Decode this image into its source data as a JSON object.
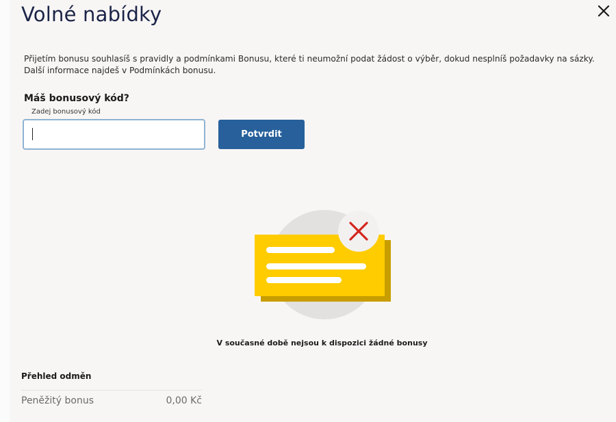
{
  "header": {
    "title": "Volné nabídky",
    "close_icon": "close-icon"
  },
  "info": {
    "line1": "Přijetím bonusu souhlasíš s pravidly a podmínkami Bonusu, které ti neumožní podat žádost o výběr, dokud nesplníš požadavky na sázky.",
    "line2": "Další informace najdeš v Podmínkách bonusu."
  },
  "bonus_code": {
    "heading": "Máš bonusový kód?",
    "label": "Zadej bonusový kód",
    "value": "",
    "confirm_label": "Potvrdit"
  },
  "empty_state": {
    "illustration_icon": "no-bonus-document-icon",
    "message": "V současné době nejsou k dispozici žádné bonusy"
  },
  "rewards": {
    "heading": "Přehled odměn",
    "items": [
      {
        "label": "Peněžitý bonus",
        "value": "0,00 Kč"
      }
    ]
  },
  "colors": {
    "title": "#1b2447",
    "button": "#27609b",
    "card_yellow": "#ffcc00",
    "card_shadow": "#c79d00",
    "close_x": "#d4261f",
    "circle_bg": "#e3e1df"
  }
}
